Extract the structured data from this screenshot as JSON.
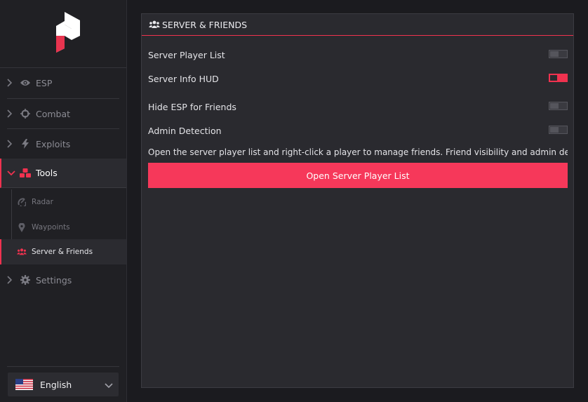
{
  "colors": {
    "accent": "#f0324f",
    "sidebar_bg": "#202024",
    "panel_bg": "#2a2a2f"
  },
  "sidebar": {
    "logo": "brand-logo",
    "items": [
      {
        "label": "ESP",
        "icon": "eye-icon"
      },
      {
        "label": "Combat",
        "icon": "crosshair-icon"
      },
      {
        "label": "Exploits",
        "icon": "bolt-icon"
      },
      {
        "label": "Tools",
        "icon": "cubes-icon",
        "expanded": true
      },
      {
        "label": "Settings",
        "icon": "gear-icon"
      }
    ],
    "sub_items": [
      {
        "label": "Radar",
        "icon": "radar-icon"
      },
      {
        "label": "Waypoints",
        "icon": "map-pin-icon"
      },
      {
        "label": "Server & Friends",
        "icon": "users-icon",
        "active": true
      }
    ],
    "language": {
      "label": "English",
      "flag": "us-flag-icon"
    }
  },
  "panel": {
    "title": "SERVER & FRIENDS",
    "toggles": [
      {
        "label": "Server Player List",
        "on": false
      },
      {
        "label": "Server Info HUD",
        "on": true
      },
      {
        "label": "Hide ESP for Friends",
        "on": false
      },
      {
        "label": "Admin Detection",
        "on": false
      }
    ],
    "description": "Open the server player list and right-click a player to manage friends. Friend visibility and admin detectio",
    "button_label": "Open Server Player List"
  }
}
